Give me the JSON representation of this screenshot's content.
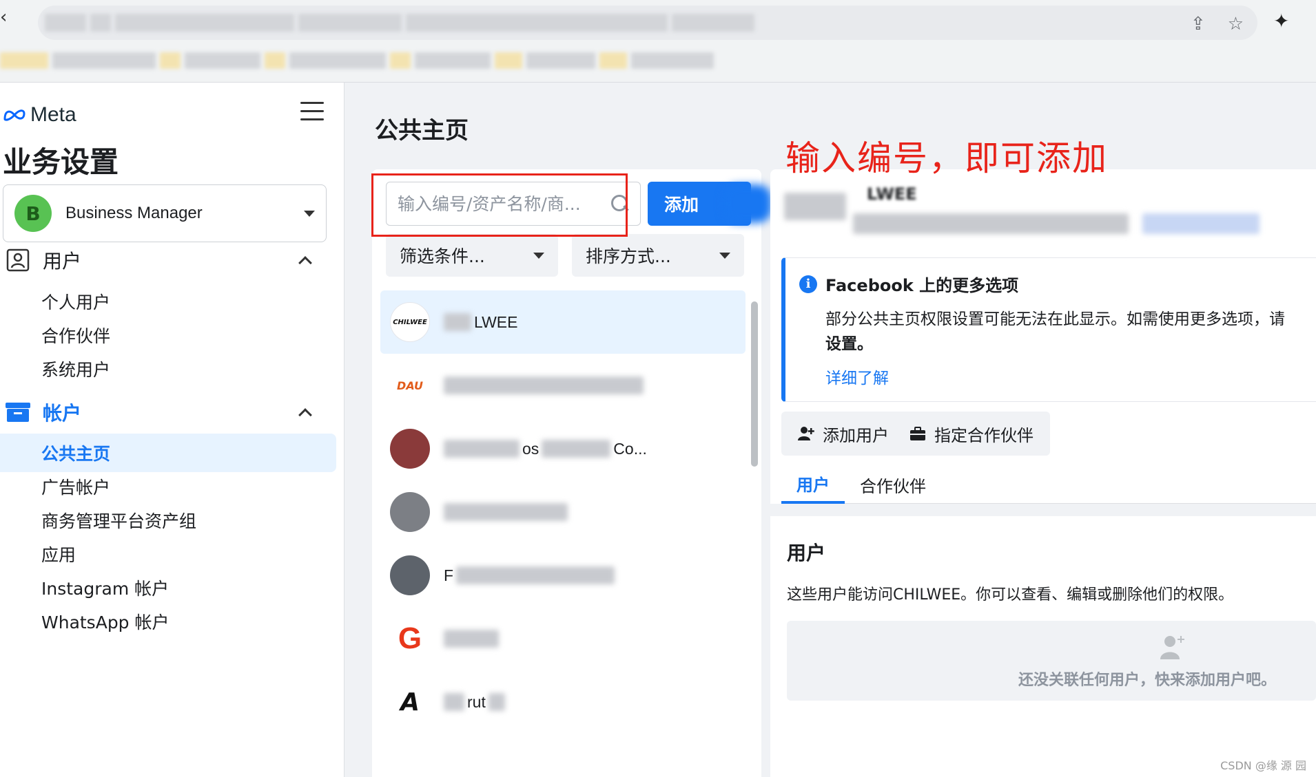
{
  "sidebar": {
    "brand": "Meta",
    "title": "业务设置",
    "business": {
      "initial": "B",
      "name": "Business Manager"
    },
    "sections": [
      {
        "label": "用户",
        "items": [
          "个人用户",
          "合作伙伴",
          "系统用户"
        ]
      },
      {
        "label": "帐户",
        "items": [
          "公共主页",
          "广告帐户",
          "商务管理平台资产组",
          "应用",
          "Instagram 帐户",
          "WhatsApp 帐户"
        ]
      }
    ],
    "selected_item": "公共主页"
  },
  "main": {
    "title": "公共主页",
    "annotation": "输入编号，即可添加",
    "search": {
      "placeholder": "输入编号/资产名称/商..."
    },
    "add_button": "添加",
    "filter_label": "筛选条件...",
    "sort_label": "排序方式...",
    "pages": [
      {
        "logo_text": "CHILWEE",
        "name_visible": "LWEE"
      },
      {
        "logo_text": "DAU",
        "name_visible": ""
      },
      {
        "logo_text": "",
        "name_visible": "os",
        "name_visible_2": "Co..."
      },
      {
        "logo_text": "",
        "name_visible": ""
      },
      {
        "logo_text": "",
        "name_visible": "F"
      },
      {
        "logo_text": "G",
        "name_visible": ""
      },
      {
        "logo_text": "A",
        "name_visible": "rut"
      }
    ]
  },
  "detail": {
    "heading_partial": "LWEE",
    "info": {
      "title": "Facebook 上的更多选项",
      "body": "部分公共主页权限设置可能无法在此显示。如需使用更多选项，请",
      "body_bold": "设置。",
      "link": "详细了解"
    },
    "actions": [
      "添加用户",
      "指定合作伙伴"
    ],
    "tabs": [
      "用户",
      "合作伙伴"
    ],
    "users": {
      "title": "用户",
      "description": "这些用户能访问CHILWEE。你可以查看、编辑或删除他们的权限。",
      "empty": "还没关联任何用户，快来添加用户吧。"
    }
  },
  "watermark": "CSDN @缘 源 园",
  "colors": {
    "accent": "#1877f2",
    "annotation": "#e8231a",
    "background": "#f0f2f5"
  },
  "icons": [
    "back-arrow-icon",
    "share-icon",
    "star-icon",
    "extension-icon",
    "meta-logo-icon",
    "menu-icon",
    "users-section-icon",
    "accounts-section-icon",
    "search-icon",
    "caret-down-icon",
    "info-icon",
    "add-person-icon",
    "briefcase-icon"
  ]
}
